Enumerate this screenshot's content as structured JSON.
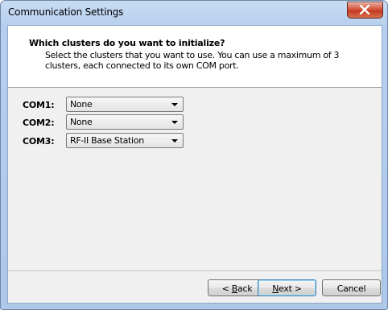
{
  "window": {
    "title": "Communication Settings"
  },
  "header": {
    "title": "Which clusters do you want to initialize?",
    "description": "Select the clusters that you want to use. You can use a maximum of 3 clusters, each connected to its own COM port."
  },
  "ports": [
    {
      "label": "COM1:",
      "value": "None"
    },
    {
      "label": "COM2:",
      "value": "None"
    },
    {
      "label": "COM3:",
      "value": "RF-II Base Station"
    }
  ],
  "buttons": {
    "back": {
      "prefix": "< ",
      "mnemonic": "B",
      "rest": "ack"
    },
    "next": {
      "mnemonic": "N",
      "rest": "ext >"
    },
    "cancel": "Cancel"
  },
  "icons": {
    "close": "close-icon",
    "dropdown": "chevron-down-icon"
  },
  "colors": {
    "titlebar": "#b7cfee",
    "close_button": "#c43a1f",
    "default_button_border": "#3c7fb1"
  }
}
